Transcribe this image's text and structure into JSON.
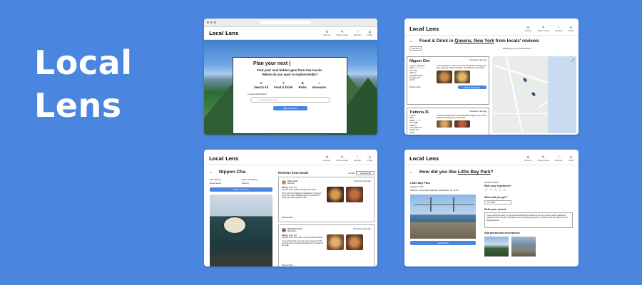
{
  "hero": {
    "line1": "Local",
    "line2": "Lens"
  },
  "app": {
    "logo": "Local Lens",
    "nav": [
      {
        "label": "Discover",
        "icon": "compass-icon"
      },
      {
        "label": "Write a review",
        "icon": "pencil-icon"
      },
      {
        "label": "Favorites",
        "icon": "heart-icon"
      },
      {
        "label": "Profile",
        "icon": "person-icon"
      }
    ]
  },
  "screen1": {
    "title": "Plan your next |",
    "subtitle1": "Find your next hidden gem from true locals–",
    "subtitle2": "Where do you want to explore Emily?",
    "categories": [
      {
        "label": "Search All",
        "icon": "search-icon"
      },
      {
        "label": "Food & Drink",
        "icon": "utensils-icon"
      },
      {
        "label": "Parks",
        "icon": "tree-icon"
      },
      {
        "label": "Museums",
        "icon": "museum-icon"
      }
    ],
    "location_label": "Location/Destination",
    "location_placeholder": "Location/Destination",
    "cta": "Take me there!"
  },
  "screen2": {
    "title_prefix": "Food & Drink in ",
    "title_place": "Queens, New York",
    "title_suffix": " from locals' reviews",
    "filter": "All Filters",
    "results": "Showing 1 out of 120 reviews",
    "listings": [
      {
        "name": "Nippon Cha",
        "reviewed": "Reviewed 1 day ago",
        "lines": [
          "Cuisine: Japanese",
          "Rating: ☆☆☆☆☆",
          "Price: $$",
          "Address:",
          "78-38 Broadway",
          "Flushing, NY",
          "11373"
        ],
        "snippet": "I love this place! I come here every weekend and always get their signature Chicken Teriyaki. The staffs are so friendly!",
        "btn": "Add to Favorites",
        "votes": "Review Votes"
      },
      {
        "name": "Trattoria 35",
        "reviewed": "Reviewed 1 day ago",
        "lines": [
          "Cuisine:",
          "Italian",
          "Rating: ☆☆☆",
          "Price: $$$",
          "Address:",
          "21-31 35th Ave",
          "Astoria, NY",
          "11106"
        ],
        "snippet": "I had their lasagna and it was AMAZING! Highly recommend getting their lasagna and the pasta!"
      }
    ]
  },
  "screen3": {
    "title": "Nippon Cha",
    "features": [
      "Fast delivery",
      "Take reservations",
      "Reservations",
      "Delivery"
    ],
    "cta": "Add to Favorites",
    "reviews_heading": "Reviews from locals",
    "sort_label": "Sort By:",
    "sort_value": "Top Reviews",
    "reviews": [
      {
        "author": "Kate Lovell",
        "location": "Brooklyn",
        "reviewed": "Reviewed 1 day ago",
        "rating": "Rating: ☆☆☆☆☆",
        "favorite": "Favorite Dish: Chicken Teriyaki Rice Bowl",
        "body": "This is the best Japanese restaurant in Queens! I come here every weekend with my friends and always get their signature dish.",
        "votes": "Review Votes"
      },
      {
        "author": "Deborah Ferreira",
        "location": "Manhattan",
        "reviewed": "Reviewed 2 days ago",
        "rating": "Rating: ☆☆☆☆☆",
        "favorite": "Favorite Dish: Curry Rice, Gyoza, Chicken Ramen",
        "body": "I love getting their curry rice and ramen here! The servings are so big and affordable for the quality of the food.",
        "votes": "Review Votes"
      }
    ]
  },
  "screen4": {
    "title_prefix": "How did you like ",
    "title_place": "Little Bay Park",
    "title_suffix": "?",
    "place_name": "Little Bay Park",
    "category": "Category: Park",
    "address": "Address: Cross Island Parkway, Whitestone, NY 11357",
    "required": "*Required fields",
    "q_rate": "Rate your experience*",
    "stars": "☆☆☆☆☆",
    "q_when": "When did you go?*",
    "date_value": "June 2023",
    "q_write": "Write your review*",
    "review_text": "I love visiting here with my friends and watching the sunset by the bay. It can be a bit crowded on weekends but it's worth it. Definitely recommend going at night if you want to see the lights from the bridge glimmer!",
    "q_photos": "Add photos and descriptions",
    "cta": "Add Photos"
  }
}
